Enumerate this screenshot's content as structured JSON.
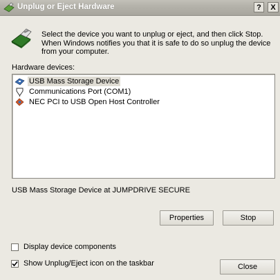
{
  "window": {
    "title": "Unplug or Eject Hardware",
    "help_button": "?",
    "close_button": "X"
  },
  "intro_text": "Select the device you want to unplug or eject, and then click Stop. When Windows notifies you that it is safe to do so unplug the device from your computer.",
  "hardware_label": "Hardware devices:",
  "devices": [
    {
      "label": "USB Mass Storage Device",
      "icon": "usb-storage-icon",
      "selected": true
    },
    {
      "label": "Communications Port (COM1)",
      "icon": "com-port-icon",
      "selected": false
    },
    {
      "label": "NEC PCI to USB Open Host Controller",
      "icon": "usb-controller-icon",
      "selected": false
    }
  ],
  "status_text": "USB Mass Storage Device at JUMPDRIVE SECURE",
  "buttons": {
    "properties": "Properties",
    "stop": "Stop",
    "close": "Close"
  },
  "options": {
    "display_components": {
      "label": "Display device components",
      "checked": false
    },
    "show_icon": {
      "label": "Show Unplug/Eject icon on the taskbar",
      "checked": true
    }
  }
}
